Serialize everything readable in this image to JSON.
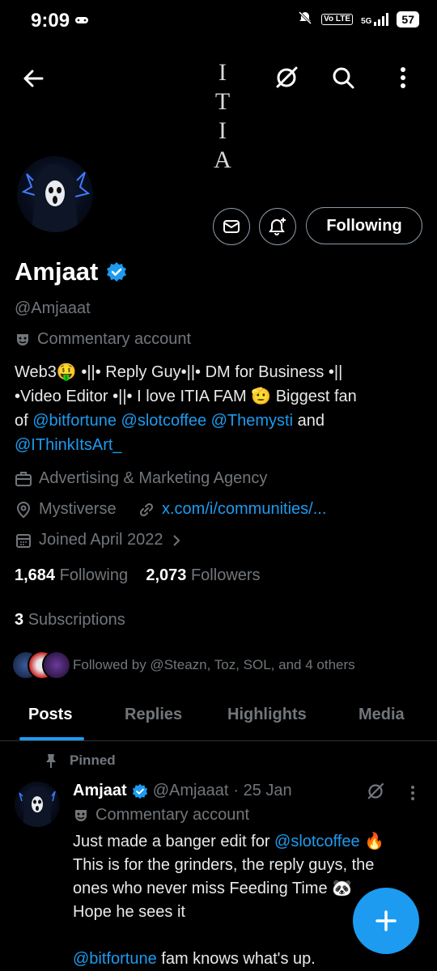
{
  "status_bar": {
    "time": "9:09",
    "network": "5G",
    "volte": "Vo LTE",
    "battery": "57"
  },
  "header": {
    "logo_letters": [
      "I",
      "T",
      "I",
      "A"
    ]
  },
  "profile": {
    "name": "Amjaat",
    "handle": "@Amjaaat",
    "label": "Commentary account",
    "following_button": "Following",
    "bio": {
      "line1": "Web3🤑 •||• Reply Guy•||• DM for Business •||",
      "line2": "•Video Editor •||• I love ITIA FAM 🫡 Biggest fan",
      "of": "of",
      "mention1": "@bitfortune",
      "mention2": "@slotcoffee",
      "mention3": "@Themysti",
      "and": "and",
      "mention4": "@IThinkItsArt_"
    },
    "category": "Advertising & Marketing Agency",
    "location": "Mystiverse",
    "website": "x.com/i/communities/...",
    "joined": "Joined April 2022",
    "following_count": "1,684",
    "following_label": "Following",
    "followers_count": "2,073",
    "followers_label": "Followers",
    "subscriptions_count": "3",
    "subscriptions_label": "Subscriptions",
    "followed_by": "Followed by @Steazn, Toz, SOL, and 4 others"
  },
  "tabs": [
    "Posts",
    "Replies",
    "Highlights",
    "Media"
  ],
  "active_tab": "Posts",
  "pinned_post": {
    "pinned_label": "Pinned",
    "name": "Amjaat",
    "handle": "@Amjaaat",
    "date": "· 25 Jan",
    "label": "Commentary account",
    "text_line1": "Just made a banger edit for",
    "text_mention": "@slotcoffee",
    "text_line1_end": "🔥",
    "text_line2": "This is for the grinders, the reply guys, the",
    "text_line3": "ones who never miss Feeding Time 🐼",
    "text_line4": "Hope he sees it",
    "text_mention2": "@bitfortune",
    "text_line5": "fam knows what's up."
  },
  "colors": {
    "background": "#000000",
    "accent": "#1d9bf0",
    "muted": "#71767b",
    "text": "#e7e9ea"
  }
}
